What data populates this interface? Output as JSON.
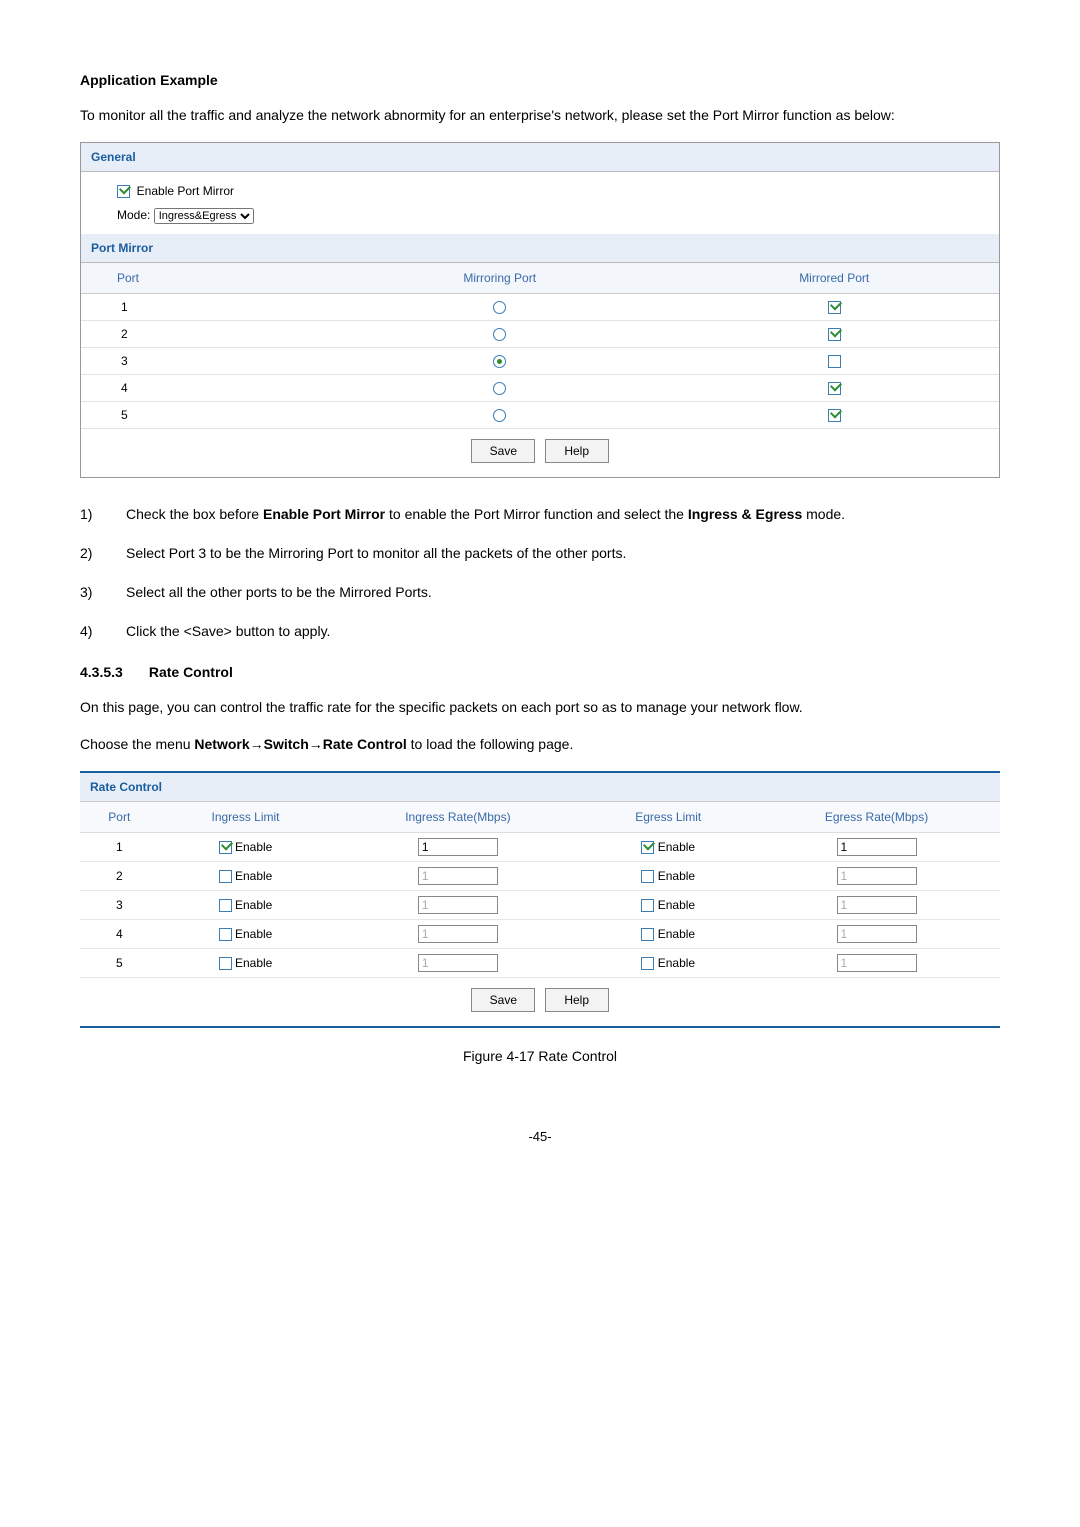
{
  "sec1": {
    "title": "Application Example",
    "intro": "To monitor all the traffic and analyze the network abnormity for an enterprise's network, please set the Port Mirror function as below:"
  },
  "general_panel": {
    "title": "General",
    "enable_label": "Enable Port Mirror",
    "mode_label": "Mode:",
    "mode_value": "Ingress&Egress"
  },
  "pm_panel": {
    "title": "Port Mirror",
    "headers": {
      "port": "Port",
      "mirroring": "Mirroring Port",
      "mirrored": "Mirrored Port"
    },
    "rows": [
      {
        "port": "1",
        "mirroring": false,
        "mirrored": true
      },
      {
        "port": "2",
        "mirroring": false,
        "mirrored": true
      },
      {
        "port": "3",
        "mirroring": true,
        "mirrored": false
      },
      {
        "port": "4",
        "mirroring": false,
        "mirrored": true
      },
      {
        "port": "5",
        "mirroring": false,
        "mirrored": true
      }
    ],
    "save": "Save",
    "help": "Help"
  },
  "steps": {
    "s1n": "1)",
    "s1a": "Check the box before ",
    "s1b": "Enable Port Mirror",
    "s1c": " to enable the Port Mirror function and select the ",
    "s1d": "Ingress & Egress",
    "s1e": " mode.",
    "s2n": "2)",
    "s2t": "Select Port 3 to be the Mirroring Port to monitor all the packets of the other ports.",
    "s3n": "3)",
    "s3t": "Select all the other ports to be the Mirrored Ports.",
    "s4n": "4)",
    "s4t": "Click the <Save> button to apply."
  },
  "sec2": {
    "num": "4.3.5.3",
    "title": "Rate Control",
    "p1": "On this page, you can control the traffic rate for the specific packets on each port so as to manage your network flow.",
    "p2a": "Choose the menu ",
    "p2b": "Network→Switch→Rate Control",
    "p2c": " to load the following page."
  },
  "rc_panel": {
    "title": "Rate Control",
    "headers": {
      "port": "Port",
      "il": "Ingress Limit",
      "ir": "Ingress Rate(Mbps)",
      "el": "Egress Limit",
      "er": "Egress Rate(Mbps)"
    },
    "enable_label": "Enable",
    "rows": [
      {
        "port": "1",
        "il": true,
        "ir": "1",
        "el": true,
        "er": "1"
      },
      {
        "port": "2",
        "il": false,
        "ir": "1",
        "el": false,
        "er": "1"
      },
      {
        "port": "3",
        "il": false,
        "ir": "1",
        "el": false,
        "er": "1"
      },
      {
        "port": "4",
        "il": false,
        "ir": "1",
        "el": false,
        "er": "1"
      },
      {
        "port": "5",
        "il": false,
        "ir": "1",
        "el": false,
        "er": "1"
      }
    ],
    "save": "Save",
    "help": "Help"
  },
  "figure": "Figure 4-17 Rate Control",
  "page": "-45-"
}
